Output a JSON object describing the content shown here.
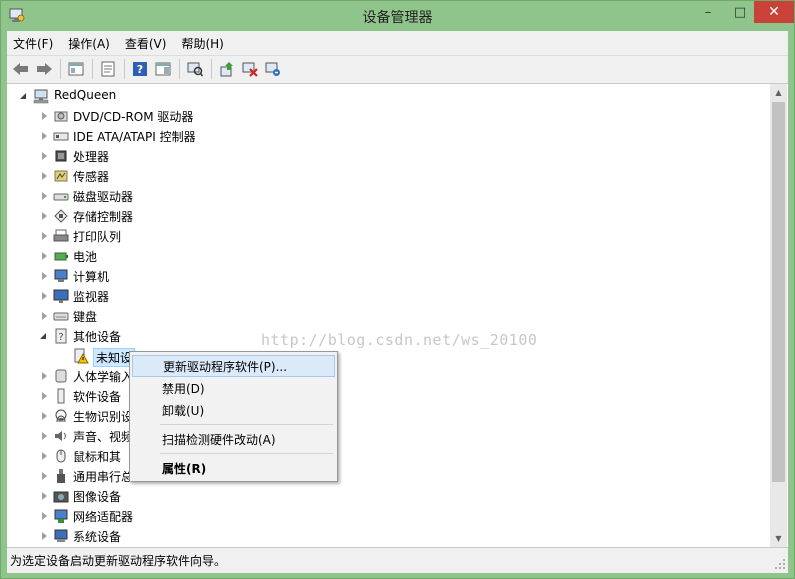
{
  "window": {
    "title": "设备管理器",
    "controls": {
      "minimize": "–",
      "maximize": "□",
      "close": "✕"
    }
  },
  "menu": [
    "文件(F)",
    "操作(A)",
    "查看(V)",
    "帮助(H)"
  ],
  "toolbar": [
    "back-icon",
    "forward-icon",
    "show-hide-tree-icon",
    "properties-icon",
    "help-icon",
    "show-hide-action-pane-icon",
    "scan-hardware-icon",
    "update-driver-icon",
    "disable-device-icon",
    "uninstall-device-icon"
  ],
  "tree": {
    "root": "RedQueen",
    "items": [
      {
        "label": "DVD/CD-ROM 驱动器",
        "icon": "dvd-drive-icon",
        "expanded": false
      },
      {
        "label": "IDE ATA/ATAPI 控制器",
        "icon": "ide-controller-icon",
        "expanded": false
      },
      {
        "label": "处理器",
        "icon": "processor-icon",
        "expanded": false
      },
      {
        "label": "传感器",
        "icon": "sensor-icon",
        "expanded": false
      },
      {
        "label": "磁盘驱动器",
        "icon": "disk-drive-icon",
        "expanded": false
      },
      {
        "label": "存储控制器",
        "icon": "storage-controller-icon",
        "expanded": false
      },
      {
        "label": "打印队列",
        "icon": "printer-icon",
        "expanded": false
      },
      {
        "label": "电池",
        "icon": "battery-icon",
        "expanded": false
      },
      {
        "label": "计算机",
        "icon": "computer-icon",
        "expanded": false
      },
      {
        "label": "监视器",
        "icon": "monitor-icon",
        "expanded": false
      },
      {
        "label": "键盘",
        "icon": "keyboard-icon",
        "expanded": false
      },
      {
        "label": "其他设备",
        "icon": "unknown-category-icon",
        "expanded": true
      },
      {
        "label": "未知设备",
        "icon": "unknown-device-warning-icon",
        "child": true,
        "selected": true,
        "visible": "未知设"
      },
      {
        "label": "人体学输入设备",
        "icon": "hid-icon",
        "expanded": false,
        "visible": "人体学输入"
      },
      {
        "label": "软件设备",
        "icon": "software-device-icon",
        "expanded": false
      },
      {
        "label": "生物识别设备",
        "icon": "biometric-icon",
        "expanded": false,
        "visible": "生物识别设"
      },
      {
        "label": "声音、视频和游戏控制器",
        "icon": "sound-icon",
        "expanded": false,
        "visible": "声音、视频"
      },
      {
        "label": "鼠标和其他指针设备",
        "icon": "mouse-icon",
        "expanded": false,
        "visible": "鼠标和其"
      },
      {
        "label": "通用串行总线控制器",
        "icon": "usb-icon",
        "expanded": false,
        "visible": "通用串行总"
      },
      {
        "label": "图像设备",
        "icon": "imaging-icon",
        "expanded": false
      },
      {
        "label": "网络适配器",
        "icon": "network-adapter-icon",
        "expanded": false
      },
      {
        "label": "系统设备",
        "icon": "system-device-icon",
        "expanded": false
      }
    ]
  },
  "watermark": "http://blog.csdn.net/ws_20100",
  "context_menu": {
    "items": [
      {
        "label": "更新驱动程序软件(P)...",
        "highlighted": true
      },
      {
        "label": "禁用(D)"
      },
      {
        "label": "卸载(U)"
      },
      {
        "separator": true
      },
      {
        "label": "扫描检测硬件改动(A)"
      },
      {
        "separator": true
      },
      {
        "label": "属性(R)",
        "bold": true
      }
    ]
  },
  "status": "为选定设备启动更新驱动程序软件向导。",
  "colors": {
    "titlebar": "#8fc48b",
    "close": "#c8423a",
    "highlight": "#dbeaf8",
    "selection": "#cde8ff"
  }
}
